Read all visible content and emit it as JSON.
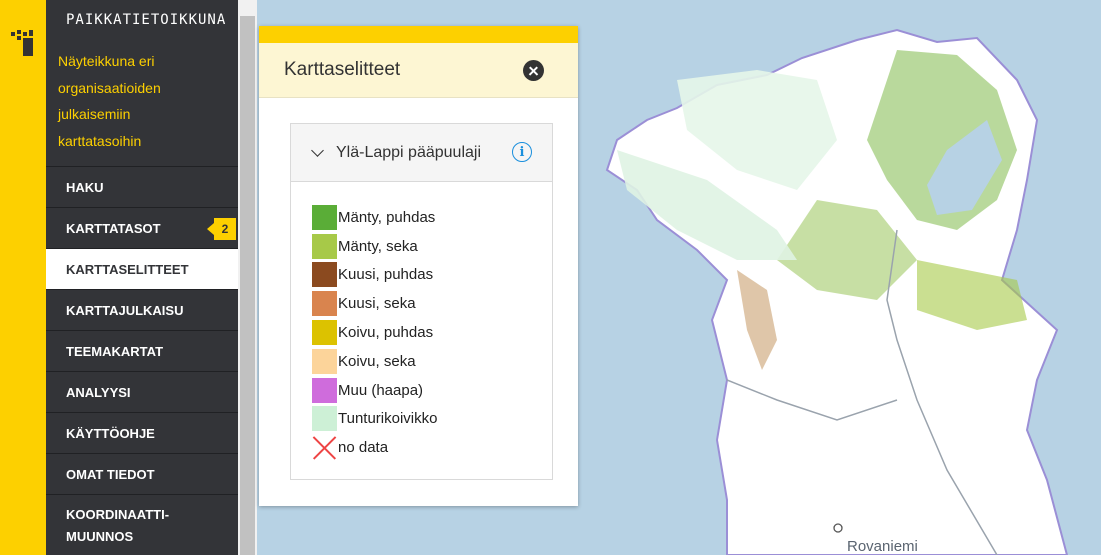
{
  "app": {
    "brand_title": "PAIKKATIETOIKKUNA",
    "tagline_lines": [
      "Näyteikkuna eri",
      "organisaatioiden",
      "julkaisemiin",
      "karttatasoihin"
    ]
  },
  "sidebar": {
    "items": [
      {
        "label": "HAKU"
      },
      {
        "label": "KARTTATASOT",
        "badge": "2"
      },
      {
        "label": "KARTTASELITTEET",
        "active": true
      },
      {
        "label": "KARTTAJULKAISU"
      },
      {
        "label": "TEEMAKARTAT"
      },
      {
        "label": "ANALYYSI"
      },
      {
        "label": "KÄYTTÖOHJE"
      },
      {
        "label": "OMAT TIEDOT"
      },
      {
        "label_lines": [
          "KOORDINAATTI-",
          "MUUNNOS"
        ]
      }
    ]
  },
  "legend_panel": {
    "title": "Karttaselitteet",
    "layer": {
      "title": "Ylä-Lappi pääpuulaji",
      "items": [
        {
          "label": "Mänty, puhdas",
          "color": "#5aad37"
        },
        {
          "label": "Mänty, seka",
          "color": "#a7c948"
        },
        {
          "label": "Kuusi, puhdas",
          "color": "#8b4a1f"
        },
        {
          "label": "Kuusi, seka",
          "color": "#d9844e"
        },
        {
          "label": "Koivu, puhdas",
          "color": "#dcc200"
        },
        {
          "label": "Koivu, seka",
          "color": "#fcd49a"
        },
        {
          "label": "Muu (haapa)",
          "color": "#cf6cdc"
        },
        {
          "label": "Tunturikoivikko",
          "color": "#cdf0d6"
        },
        {
          "label": "no data",
          "color": "#ee4444",
          "no_data": true
        }
      ]
    }
  },
  "map": {
    "place_label": "Rovaniemi",
    "colors": {
      "water": "#b7d2e4",
      "land": "#ffffff",
      "border": "#9b8fd6"
    }
  }
}
